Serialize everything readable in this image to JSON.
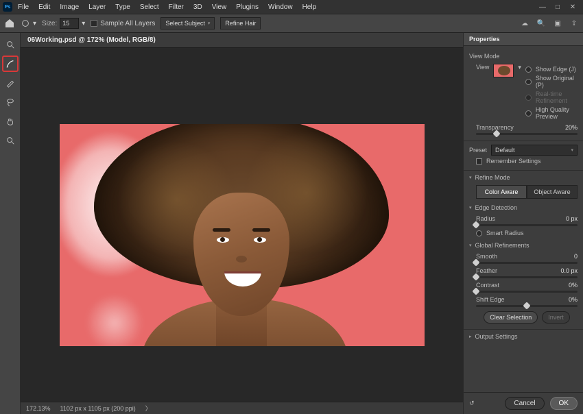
{
  "app": {
    "logo": "Ps"
  },
  "menu": [
    "File",
    "Edit",
    "Image",
    "Layer",
    "Type",
    "Select",
    "Filter",
    "3D",
    "View",
    "Plugins",
    "Window",
    "Help"
  ],
  "window_controls": {
    "min": "—",
    "max": "□",
    "close": "✕"
  },
  "options_bar": {
    "size_label": "Size:",
    "size_value": "15",
    "sample_label": "Sample All Layers",
    "select_subject": "Select Subject",
    "refine_hair": "Refine Hair"
  },
  "tools": [
    {
      "name": "quick-select-tool"
    },
    {
      "name": "refine-edge-brush-tool",
      "selected": true
    },
    {
      "name": "brush-tool"
    },
    {
      "name": "lasso-tool"
    },
    {
      "name": "hand-tool"
    },
    {
      "name": "zoom-tool"
    }
  ],
  "document": {
    "tab_title": "06Working.psd @ 172% (Model, RGB/8)",
    "zoom": "172.13%",
    "dimensions": "1102 px x 1105 px (200 ppi)"
  },
  "panel": {
    "title": "Properties",
    "view_mode": {
      "title": "View Mode",
      "view_label": "View",
      "show_edge": "Show Edge (J)",
      "show_original": "Show Original (P)",
      "realtime": "Real-time Refinement",
      "high_quality": "High Quality Preview"
    },
    "transparency": {
      "label": "Transparency",
      "value": "20%"
    },
    "preset": {
      "label": "Preset",
      "value": "Default"
    },
    "remember": "Remember Settings",
    "refine_mode": {
      "title": "Refine Mode",
      "color_aware": "Color Aware",
      "object_aware": "Object Aware"
    },
    "edge_detection": {
      "title": "Edge Detection",
      "radius_label": "Radius",
      "radius_value": "0 px",
      "smart_radius": "Smart Radius"
    },
    "global": {
      "title": "Global Refinements",
      "smooth_label": "Smooth",
      "smooth_value": "0",
      "feather_label": "Feather",
      "feather_value": "0.0 px",
      "contrast_label": "Contrast",
      "contrast_value": "0%",
      "shift_label": "Shift Edge",
      "shift_value": "0%",
      "clear_selection": "Clear Selection",
      "invert": "Invert"
    },
    "output": {
      "title": "Output Settings"
    },
    "footer": {
      "cancel": "Cancel",
      "ok": "OK"
    }
  }
}
